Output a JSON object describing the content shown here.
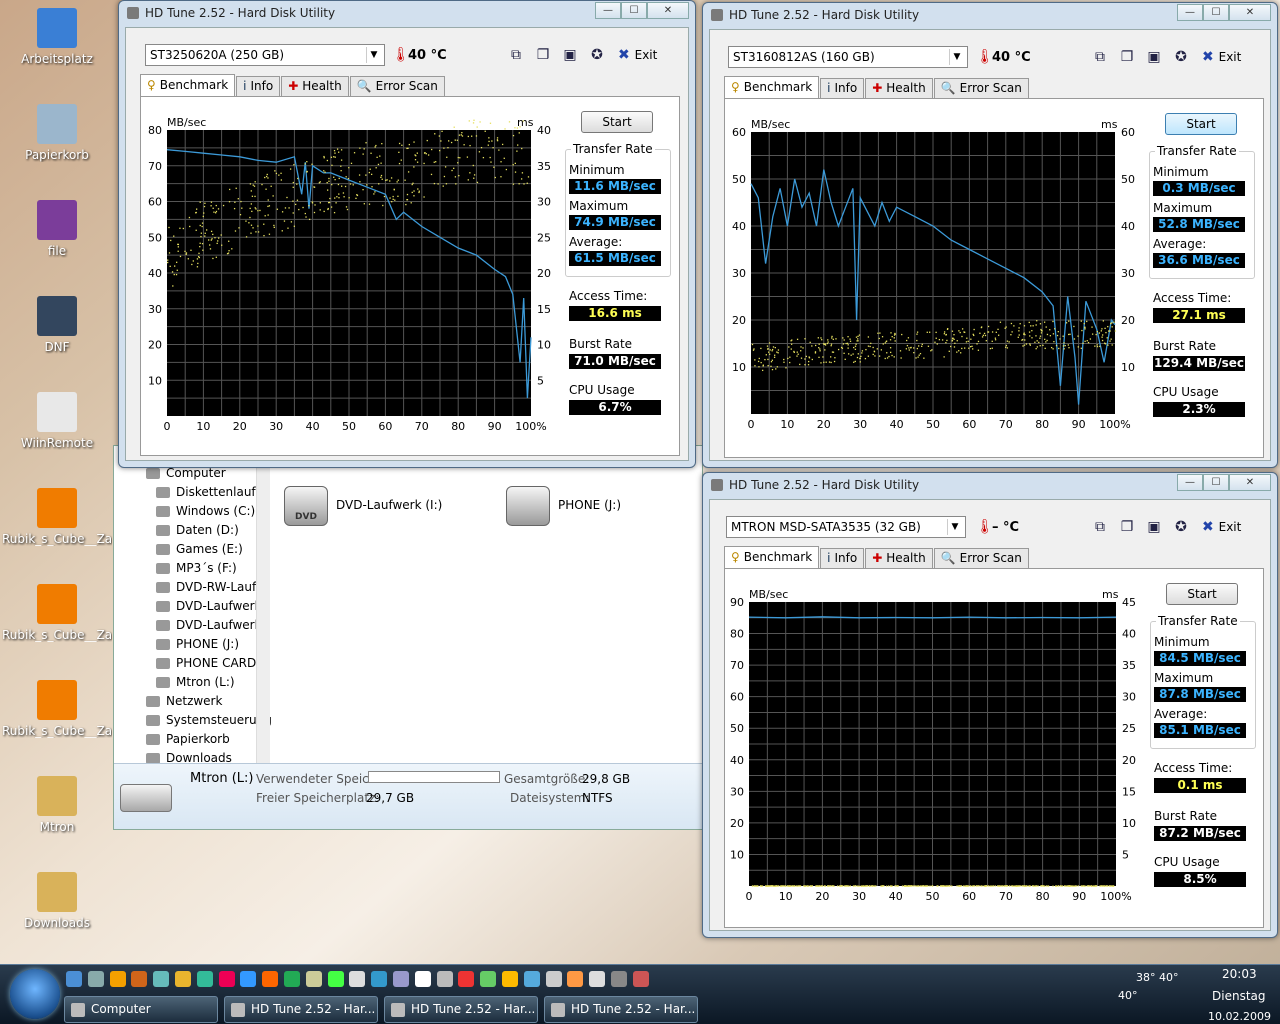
{
  "desktop_icons": [
    {
      "label": "Arbeitsplatz",
      "color": "#3a7fd5"
    },
    {
      "label": "Papierkorb",
      "color": "#9bb6cc"
    },
    {
      "label": "file",
      "color": "#7b3d9a"
    },
    {
      "label": "DNF",
      "color": "#33465e"
    },
    {
      "label": "WiinRemote",
      "color": "#e8e8e8"
    },
    {
      "label": "Rubik_s_Cube__Zau...",
      "color": "#f07c00"
    },
    {
      "label": "Rubik_s_Cube__Zau...",
      "color": "#f07c00"
    },
    {
      "label": "Rubik_s_Cube__Zau...",
      "color": "#f07c00"
    },
    {
      "label": "Mtron",
      "color": "#d9b25a"
    },
    {
      "label": "Downloads",
      "color": "#d9b25a"
    }
  ],
  "explorer": {
    "nav_items": [
      "Computer",
      "Diskettenlaufw",
      "Windows (C:)",
      "Daten (D:)",
      "Games (E:)",
      "MP3´s (F:)",
      "DVD-RW-Laufv",
      "DVD-Laufwerk",
      "DVD-Laufwerk",
      "PHONE (J:)",
      "PHONE CARD",
      "Mtron (L:)",
      "Netzwerk",
      "Systemsteuerung",
      "Papierkorb",
      "Downloads"
    ],
    "drives": [
      {
        "label": "DVD-Laufwerk (I:)",
        "icon_text": "DVD"
      },
      {
        "label": "PHONE (J:)",
        "icon_text": ""
      }
    ],
    "details": {
      "name": "Mtron (L:)",
      "used_label": "Verwendeter Speic...",
      "free_label": "Freier Speicherplatz:",
      "free_value": "29,7 GB",
      "total_label": "Gesamtgröße:",
      "total_value": "29,8 GB",
      "fs_label": "Dateisystem:",
      "fs_value": "NTFS"
    }
  },
  "common": {
    "tabs": [
      "Benchmark",
      "Info",
      "Health",
      "Error Scan"
    ],
    "start": "Start",
    "exit": "Exit",
    "transfer_rate": "Transfer Rate",
    "minimum": "Minimum",
    "maximum": "Maximum",
    "average": "Average:",
    "access_time": "Access Time:",
    "burst_rate": "Burst Rate",
    "cpu_usage": "CPU Usage",
    "mbsec": "MB/sec",
    "ms": "ms"
  },
  "windows": [
    {
      "title": "HD Tune 2.52 - Hard Disk Utility",
      "drive": "ST3250620A (250 GB)",
      "temp": "40 °C",
      "min": "11.6 MB/sec",
      "max": "74.9 MB/sec",
      "avg": "61.5 MB/sec",
      "access": "16.6 ms",
      "burst": "71.0 MB/sec",
      "cpu": "6.7%"
    },
    {
      "title": "HD Tune 2.52 - Hard Disk Utility",
      "drive": "ST3160812AS (160 GB)",
      "temp": "40 °C",
      "min": "0.3 MB/sec",
      "max": "52.8 MB/sec",
      "avg": "36.6 MB/sec",
      "access": "27.1 ms",
      "burst": "129.4 MB/sec",
      "cpu": "2.3%"
    },
    {
      "title": "HD Tune 2.52 - Hard Disk Utility",
      "drive": "MTRON MSD-SATA3535 (32 GB)",
      "temp": "– °C",
      "min": "84.5 MB/sec",
      "max": "87.8 MB/sec",
      "avg": "85.1 MB/sec",
      "access": "0.1 ms",
      "burst": "87.2 MB/sec",
      "cpu": "8.5%"
    }
  ],
  "chart_data": [
    {
      "type": "line",
      "x_label": "%",
      "xlim": [
        0,
        100
      ],
      "x_ticks": [
        "0",
        "10",
        "20",
        "30",
        "40",
        "50",
        "60",
        "70",
        "80",
        "90",
        "100%"
      ],
      "y_label": "MB/sec",
      "ylim": [
        0,
        80
      ],
      "y_ticks": [
        "80",
        "70",
        "60",
        "50",
        "40",
        "30",
        "20",
        "10"
      ],
      "y2_label": "ms",
      "y2lim": [
        0,
        40
      ],
      "y2_ticks": [
        "40",
        "35",
        "30",
        "25",
        "20",
        "15",
        "10",
        "5"
      ],
      "series": [
        {
          "color": "#3c9ad8",
          "x": [
            0,
            5,
            10,
            15,
            20,
            25,
            30,
            35,
            37,
            38,
            39,
            40,
            43,
            45,
            50,
            55,
            60,
            63,
            65,
            70,
            75,
            80,
            85,
            90,
            93,
            95,
            97,
            98,
            99,
            100
          ],
          "y": [
            74.5,
            74,
            73.5,
            73,
            72.5,
            71.5,
            71,
            72.5,
            62,
            71,
            58,
            70,
            68,
            68,
            66,
            64,
            62,
            55,
            57,
            53,
            50,
            47,
            45,
            41,
            39,
            34,
            15,
            33,
            5,
            22
          ]
        },
        {
          "color": "#e6e060",
          "style": "scatter",
          "x": [
            0,
            5,
            10,
            15,
            20,
            25,
            30,
            35,
            40,
            45,
            50,
            55,
            60,
            65,
            70,
            75,
            80,
            85,
            90,
            95,
            100
          ],
          "y": [
            22,
            24,
            26,
            27,
            28,
            29,
            30,
            31,
            32,
            33,
            33,
            34,
            34,
            34,
            35,
            36,
            37,
            37,
            37,
            37,
            37
          ]
        }
      ]
    },
    {
      "type": "line",
      "x_label": "%",
      "xlim": [
        0,
        100
      ],
      "x_ticks": [
        "0",
        "10",
        "20",
        "30",
        "40",
        "50",
        "60",
        "70",
        "80",
        "90",
        "100%"
      ],
      "y_label": "MB/sec",
      "ylim": [
        0,
        60
      ],
      "y_ticks": [
        "60",
        "50",
        "40",
        "30",
        "20",
        "10"
      ],
      "y2_label": "ms",
      "y2lim": [
        0,
        60
      ],
      "y2_ticks": [
        "60",
        "50",
        "40",
        "30",
        "20",
        "10"
      ],
      "series": [
        {
          "color": "#3c9ad8",
          "x": [
            0,
            2,
            4,
            6,
            8,
            10,
            12,
            14,
            16,
            18,
            20,
            22,
            24,
            26,
            28,
            29,
            30,
            32,
            34,
            36,
            38,
            40,
            45,
            50,
            55,
            60,
            65,
            70,
            75,
            80,
            83,
            85,
            87,
            89,
            90,
            92,
            95,
            97,
            99,
            100
          ],
          "y": [
            49,
            46,
            32,
            42,
            48,
            40,
            50,
            44,
            47,
            40,
            52,
            45,
            40,
            44,
            48,
            20,
            46,
            43,
            40,
            45,
            41,
            44,
            42,
            40,
            37,
            35,
            33,
            31,
            29,
            26,
            23,
            6,
            25,
            12,
            2,
            24,
            18,
            11,
            20,
            19
          ]
        },
        {
          "color": "#e6e060",
          "style": "scatter",
          "x": [
            0,
            10,
            20,
            30,
            40,
            50,
            60,
            70,
            80,
            90,
            100
          ],
          "y": [
            12,
            13,
            14,
            14,
            15,
            15,
            16,
            17,
            17,
            17,
            17
          ]
        }
      ]
    },
    {
      "type": "line",
      "x_label": "%",
      "xlim": [
        0,
        100
      ],
      "x_ticks": [
        "0",
        "10",
        "20",
        "30",
        "40",
        "50",
        "60",
        "70",
        "80",
        "90",
        "100%"
      ],
      "y_label": "MB/sec",
      "ylim": [
        0,
        90
      ],
      "y_ticks": [
        "90",
        "80",
        "70",
        "60",
        "50",
        "40",
        "30",
        "20",
        "10"
      ],
      "y2_label": "ms",
      "y2lim": [
        0,
        45
      ],
      "y2_ticks": [
        "45",
        "40",
        "35",
        "30",
        "25",
        "20",
        "15",
        "10",
        "5"
      ],
      "series": [
        {
          "color": "#3c9ad8",
          "x": [
            0,
            10,
            20,
            30,
            40,
            50,
            60,
            70,
            80,
            90,
            100
          ],
          "y": [
            85.2,
            85,
            85.3,
            85,
            85.1,
            85,
            85.2,
            85,
            85.1,
            85,
            85.2
          ]
        },
        {
          "color": "#e6e060",
          "style": "scatter",
          "x": [
            0,
            50,
            100
          ],
          "y": [
            0.1,
            0.1,
            0.1
          ]
        }
      ]
    }
  ],
  "taskbar": {
    "buttons": [
      "Computer",
      "HD Tune 2.52 - Har...",
      "HD Tune 2.52 - Har...",
      "HD Tune 2.52 - Har..."
    ],
    "temp1": "38° 40°",
    "temp2": "40°",
    "time": "20:03",
    "day": "Dienstag",
    "date": "10.02.2009"
  }
}
